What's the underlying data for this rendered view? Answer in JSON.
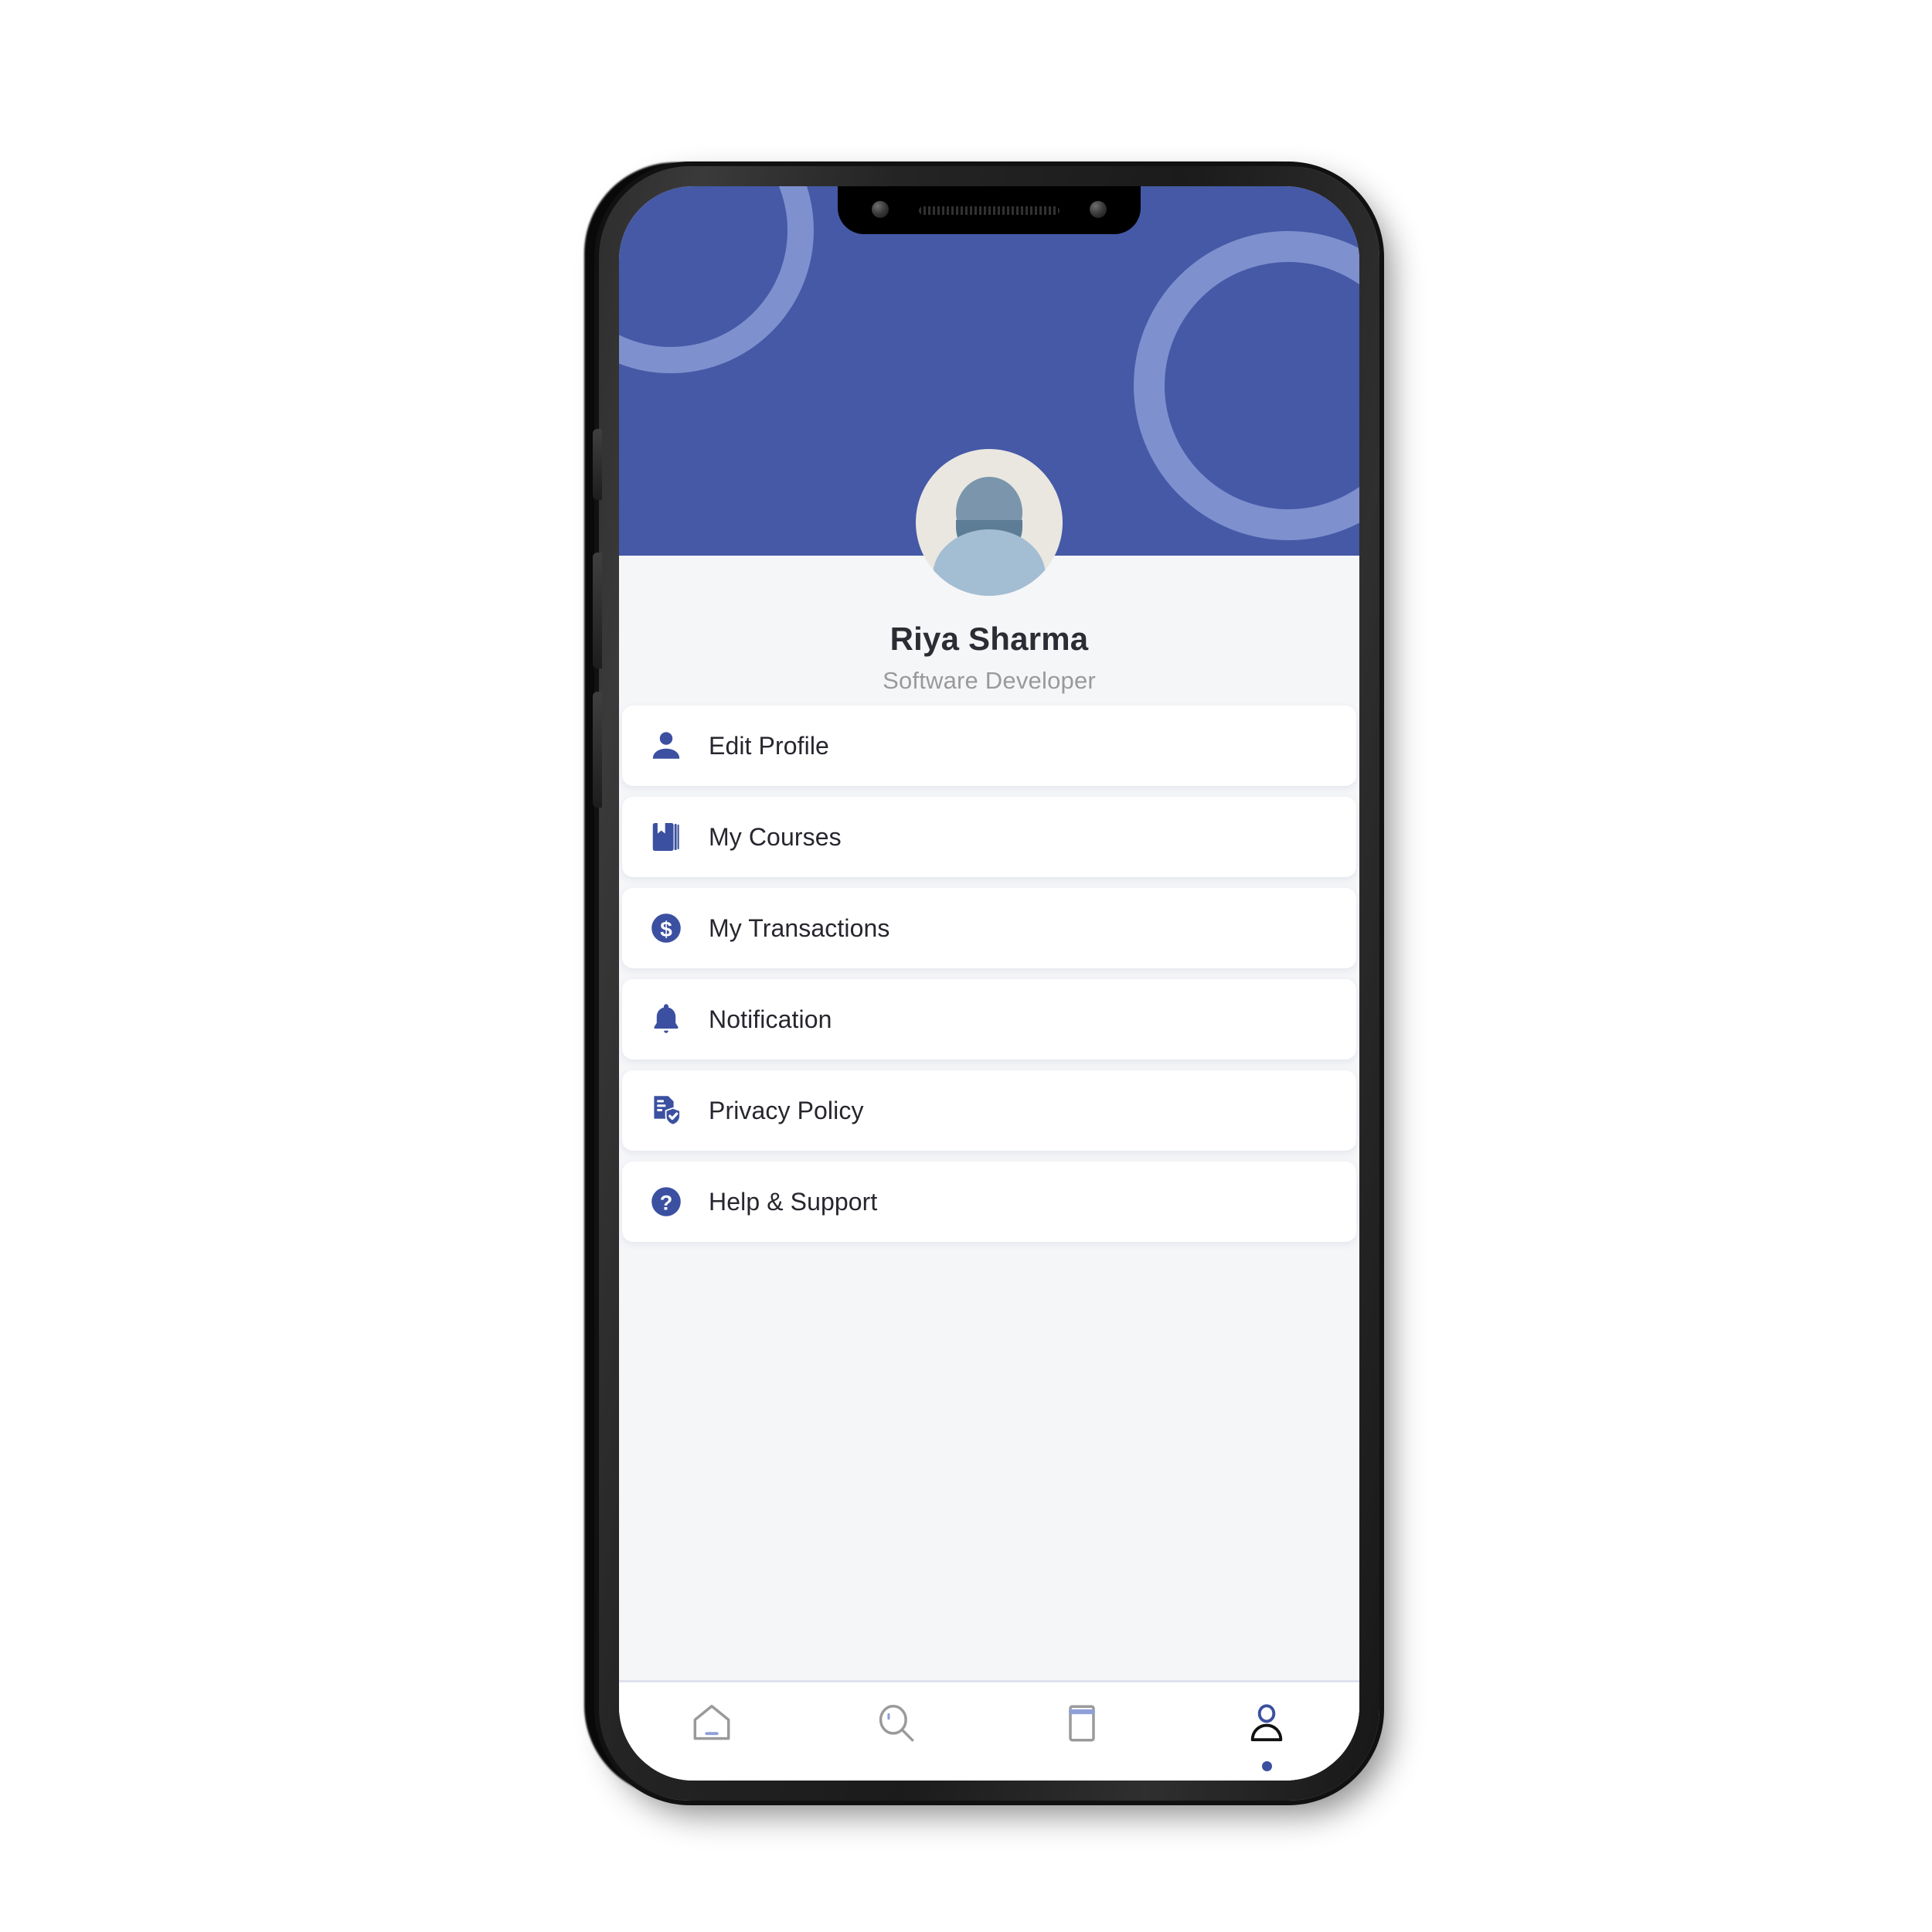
{
  "theme": {
    "brand_blue": "#4559A6",
    "ring_blue": "#7E90CE",
    "icon_blue": "#3B50A0",
    "sheet_bg": "#F5F6F8",
    "card_bg": "#FFFFFF",
    "name_color": "#2C2C34",
    "role_color": "#9A9A9A",
    "nav_inactive": "#9A9A9A",
    "nav_active": "#1A1A1A"
  },
  "header": {
    "decorations": [
      {
        "name": "ring-top-left"
      },
      {
        "name": "ring-right"
      }
    ]
  },
  "profile": {
    "avatar_name": "user-avatar",
    "name": "Riya Sharma",
    "role": "Software Developer"
  },
  "menu": {
    "items": [
      {
        "label": "Edit Profile",
        "icon": "person-icon"
      },
      {
        "label": "My Courses",
        "icon": "book-bookmark-icon"
      },
      {
        "label": "My Transactions",
        "icon": "dollar-circle-icon"
      },
      {
        "label": "Notification",
        "icon": "bell-icon"
      },
      {
        "label": "Privacy Policy",
        "icon": "document-shield-check-icon"
      },
      {
        "label": "Help & Support",
        "icon": "question-circle-icon"
      }
    ]
  },
  "bottom_nav": {
    "items": [
      {
        "label": "Home",
        "icon": "home-icon",
        "active": false
      },
      {
        "label": "Search",
        "icon": "search-icon",
        "active": false
      },
      {
        "label": "Library",
        "icon": "book-icon",
        "active": false
      },
      {
        "label": "Profile",
        "icon": "profile-icon",
        "active": true
      }
    ]
  },
  "device": {
    "notch": {
      "camera_left": "camera-dot",
      "camera_right": "camera-dot",
      "speaker": "speaker-grille"
    }
  }
}
